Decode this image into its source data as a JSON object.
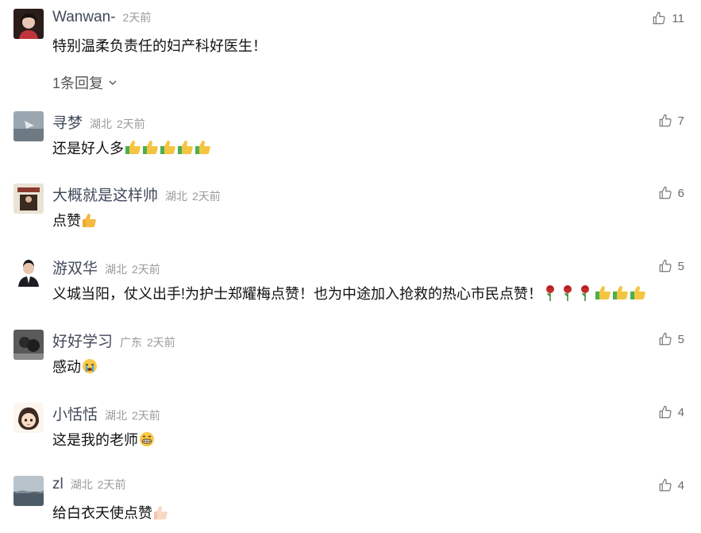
{
  "comments": [
    {
      "user": "Wanwan-",
      "location": "",
      "time": "2天前",
      "likes": "11",
      "text": "特别温柔负责任的妇产科好医生！",
      "replies": "1条回复"
    },
    {
      "user": "寻梦",
      "location": "湖北",
      "time": "2天前",
      "likes": "7",
      "text": "还是好人多"
    },
    {
      "user": "大概就是这样帅",
      "location": "湖北",
      "time": "2天前",
      "likes": "6",
      "text": "点赞"
    },
    {
      "user": "游双华",
      "location": "湖北",
      "time": "2天前",
      "likes": "5",
      "text": "义城当阳，仗义出手!为护士郑耀梅点赞！也为中途加入抢救的热心市民点赞！"
    },
    {
      "user": "好好学习",
      "location": "广东",
      "time": "2天前",
      "likes": "5",
      "text": "感动"
    },
    {
      "user": "小恬恬",
      "location": "湖北",
      "time": "2天前",
      "likes": "4",
      "text": "这是我的老师"
    },
    {
      "user": "zl",
      "location": "湖北",
      "time": "2天前",
      "likes": "4",
      "text": "给白衣天使点赞"
    }
  ],
  "icons": {
    "like": "thumbs-up-outline-icon",
    "expand": "chevron-down-icon"
  },
  "colors": {
    "username": "#40495a",
    "meta": "#9a9a9a",
    "text": "#111111"
  }
}
